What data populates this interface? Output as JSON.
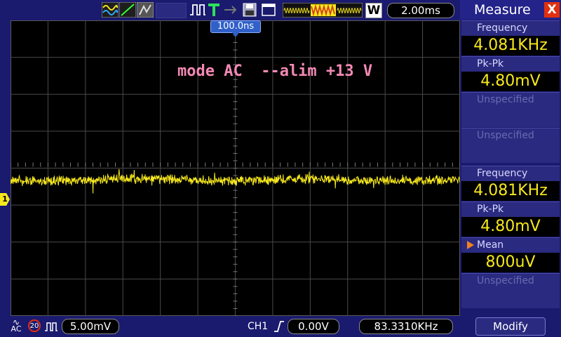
{
  "header": {
    "timebase": "2.00ms",
    "trigger_mode_letter": "W",
    "trigger_position": "100.0ns"
  },
  "annotation": "mode AC  --alim +13 V",
  "channel": {
    "marker": "1",
    "coupling": "AC",
    "bw_limit": "20",
    "scale": "5.00mV",
    "trig_source": "CH1",
    "trig_level": "0.00V",
    "frequency_counter": "83.3310KHz"
  },
  "measure_panel": {
    "title": "Measure",
    "close": "X",
    "ch1": {
      "freq_label": "Frequency",
      "freq_value": "4.081KHz",
      "pkpk_label": "Pk-Pk",
      "pkpk_value": "4.80mV",
      "slot3_label": "Unspecified",
      "slot4_label": "Unspecified"
    },
    "ch2": {
      "freq_label": "Frequency",
      "freq_value": "4.081KHz",
      "pkpk_label": "Pk-Pk",
      "pkpk_value": "4.80mV",
      "mean_label": "Mean",
      "mean_value": "800uV",
      "slot4_label": "Unspecified"
    },
    "modify_label": "Modify"
  },
  "colors": {
    "trace": "#f7e81c",
    "annotation": "#f48ab4",
    "ui_background": "#1a1a6e"
  }
}
